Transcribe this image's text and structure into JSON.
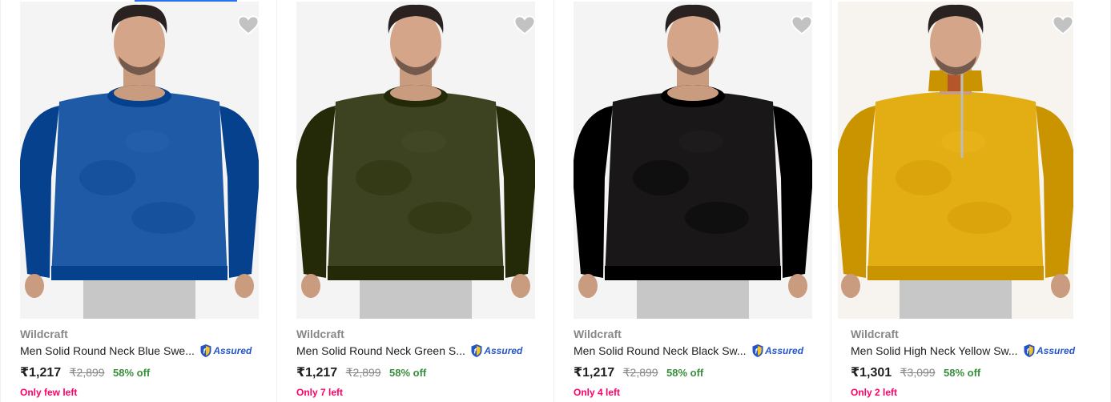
{
  "products": [
    {
      "brand": "Wildcraft",
      "title": "Men Solid Round Neck Blue Swe...",
      "assured_label": "Assured",
      "price": "₹1,217",
      "mrp": "₹2,899",
      "discount": "58% off",
      "stock": "Only few left",
      "sweater_color": "#1f5aa6",
      "background_color": "#f4f4f4"
    },
    {
      "brand": "Wildcraft",
      "title": "Men Solid Round Neck Green S...",
      "assured_label": "Assured",
      "price": "₹1,217",
      "mrp": "₹2,899",
      "discount": "58% off",
      "stock": "Only 7 left",
      "sweater_color": "#3d4220",
      "background_color": "#f4f4f4"
    },
    {
      "brand": "Wildcraft",
      "title": "Men Solid Round Neck Black Sw...",
      "assured_label": "Assured",
      "price": "₹1,217",
      "mrp": "₹2,899",
      "discount": "58% off",
      "stock": "Only 4 left",
      "sweater_color": "#1a1718",
      "background_color": "#f4f4f4"
    },
    {
      "brand": "Wildcraft",
      "title": "Men Solid High Neck Yellow Sw...",
      "assured_label": "Assured",
      "price": "₹1,301",
      "mrp": "₹3,099",
      "discount": "58% off",
      "stock": "Only 2 left",
      "sweater_color": "#e3ad14",
      "background_color": "#f7f3ee"
    }
  ],
  "colors": {
    "accent": "#2874f0",
    "discount": "#388e3c",
    "stock_warning": "#ff0066",
    "assured": "#2455c8",
    "wishlist_heart": "#c2c2c2"
  }
}
